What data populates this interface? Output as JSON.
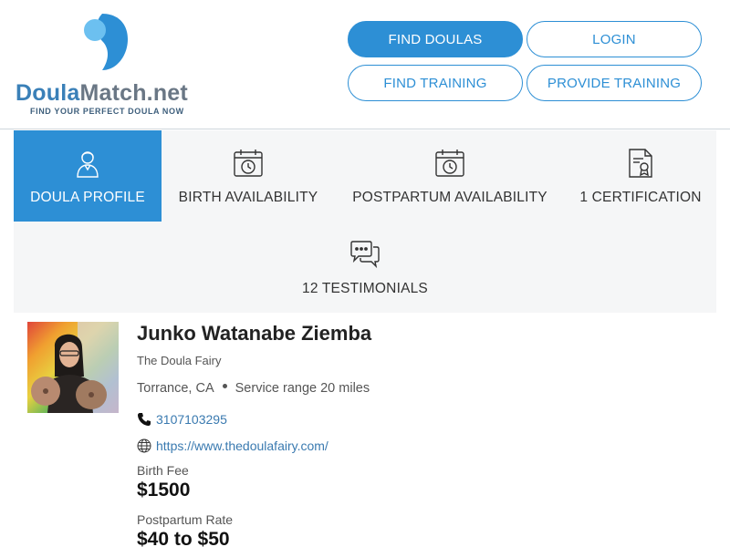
{
  "logo": {
    "name_part1": "Doula",
    "name_part2": "Match.net",
    "tagline": "FIND YOUR PERFECT DOULA NOW"
  },
  "nav": {
    "find_doulas": "FIND DOULAS",
    "login": "LOGIN",
    "find_training": "FIND TRAINING",
    "provide_training": "PROVIDE TRAINING"
  },
  "tabs": [
    {
      "label": "DOULA PROFILE",
      "icon": "doula-profile-icon",
      "active": true
    },
    {
      "label": "BIRTH AVAILABILITY",
      "icon": "calendar-clock-icon",
      "active": false
    },
    {
      "label": "POSTPARTUM AVAILABILITY",
      "icon": "calendar-clock-icon",
      "active": false
    },
    {
      "label": "1 CERTIFICATION",
      "icon": "certificate-icon",
      "active": false
    },
    {
      "label": "12 TESTIMONIALS",
      "icon": "chat-bubbles-icon",
      "active": false
    }
  ],
  "profile": {
    "name": "Junko Watanabe Ziemba",
    "business": "The Doula Fairy",
    "location": "Torrance, CA",
    "service_range": "Service range 20 miles",
    "phone": "3107103295",
    "website": "https://www.thedoulafairy.com/",
    "birth_fee_label": "Birth Fee",
    "birth_fee": "$1500",
    "postpartum_rate_label": "Postpartum Rate",
    "postpartum_rate": "$40 to $50"
  },
  "colors": {
    "accent": "#2d8fd5",
    "tab_background": "#f5f6f7",
    "link": "#3a7ab0"
  }
}
